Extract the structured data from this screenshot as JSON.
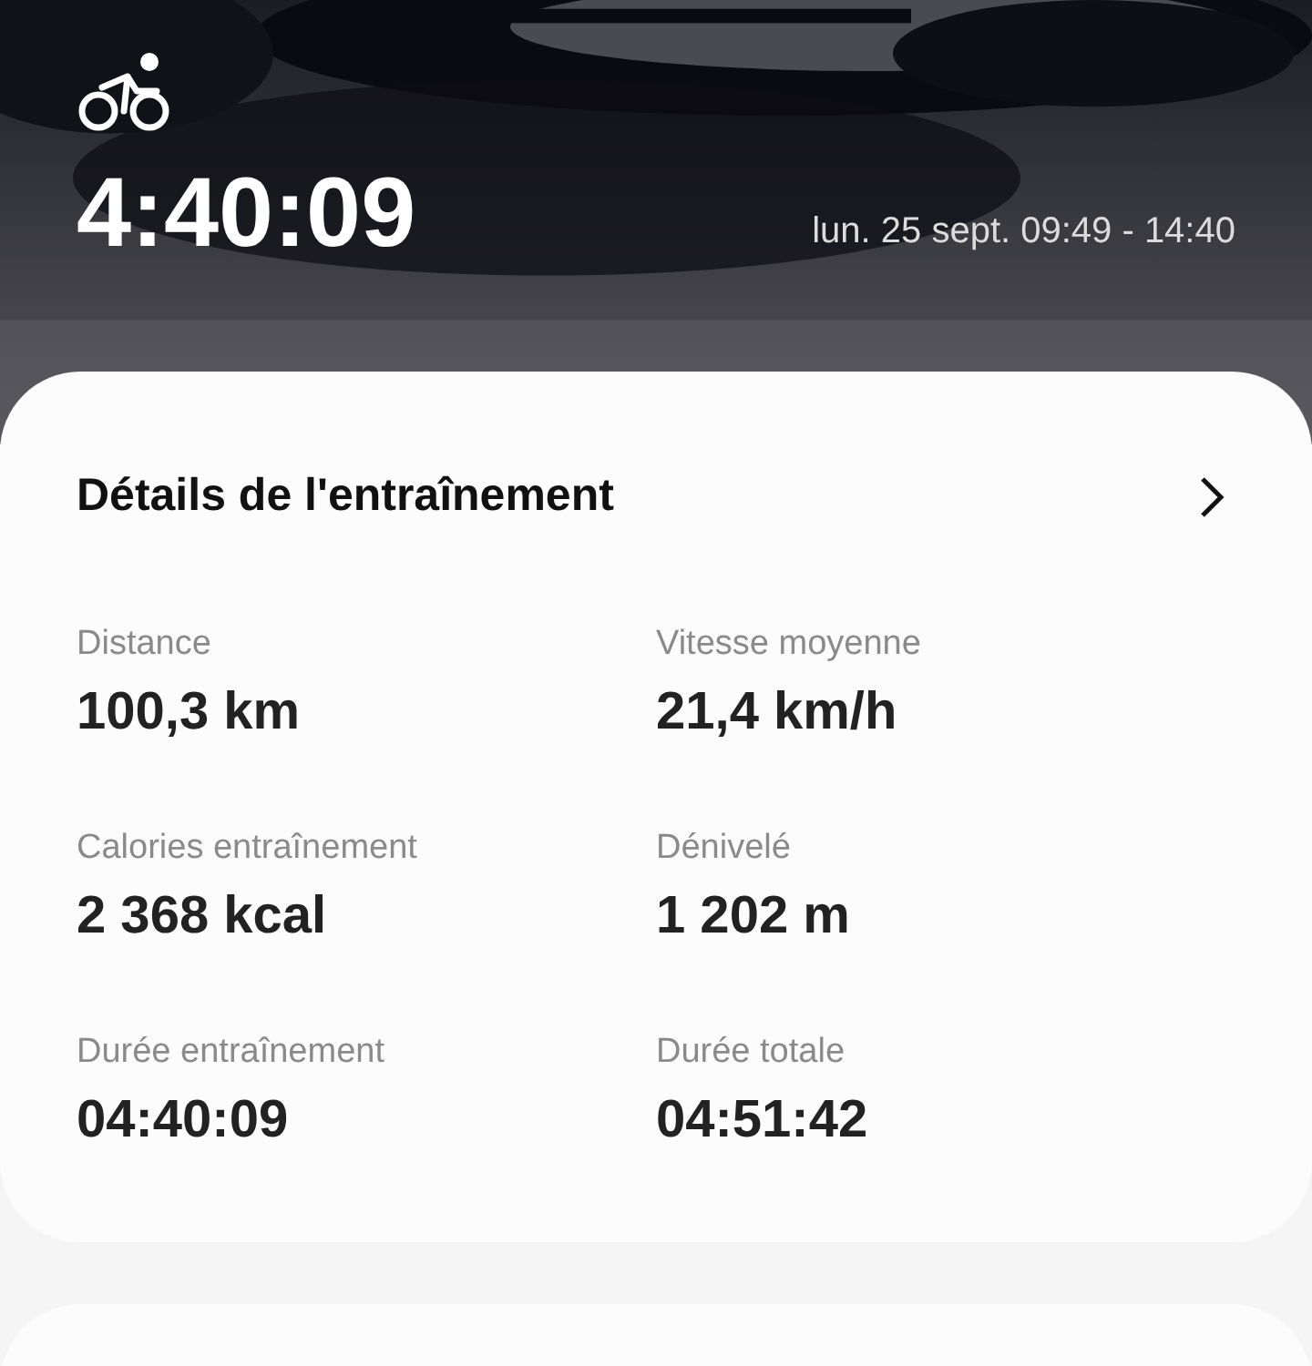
{
  "header": {
    "kind": "picture",
    "duration": "4:40:09",
    "date_range": "lun. 25 sept. 09:49 - 14:40"
  },
  "details": {
    "title": "Détails de l'entraînement",
    "stats": [
      {
        "label": "Distance",
        "value": "100,3 km"
      },
      {
        "label": "Vitesse moyenne",
        "value": "21,4 km/h"
      },
      {
        "label": "Calories entraînement",
        "value": "2 368 kcal"
      },
      {
        "label": "Dénivelé",
        "value": "1 202 m"
      },
      {
        "label": "Durée entraînement",
        "value": "04:40:09"
      },
      {
        "label": "Durée totale",
        "value": "04:51:42"
      }
    ]
  }
}
